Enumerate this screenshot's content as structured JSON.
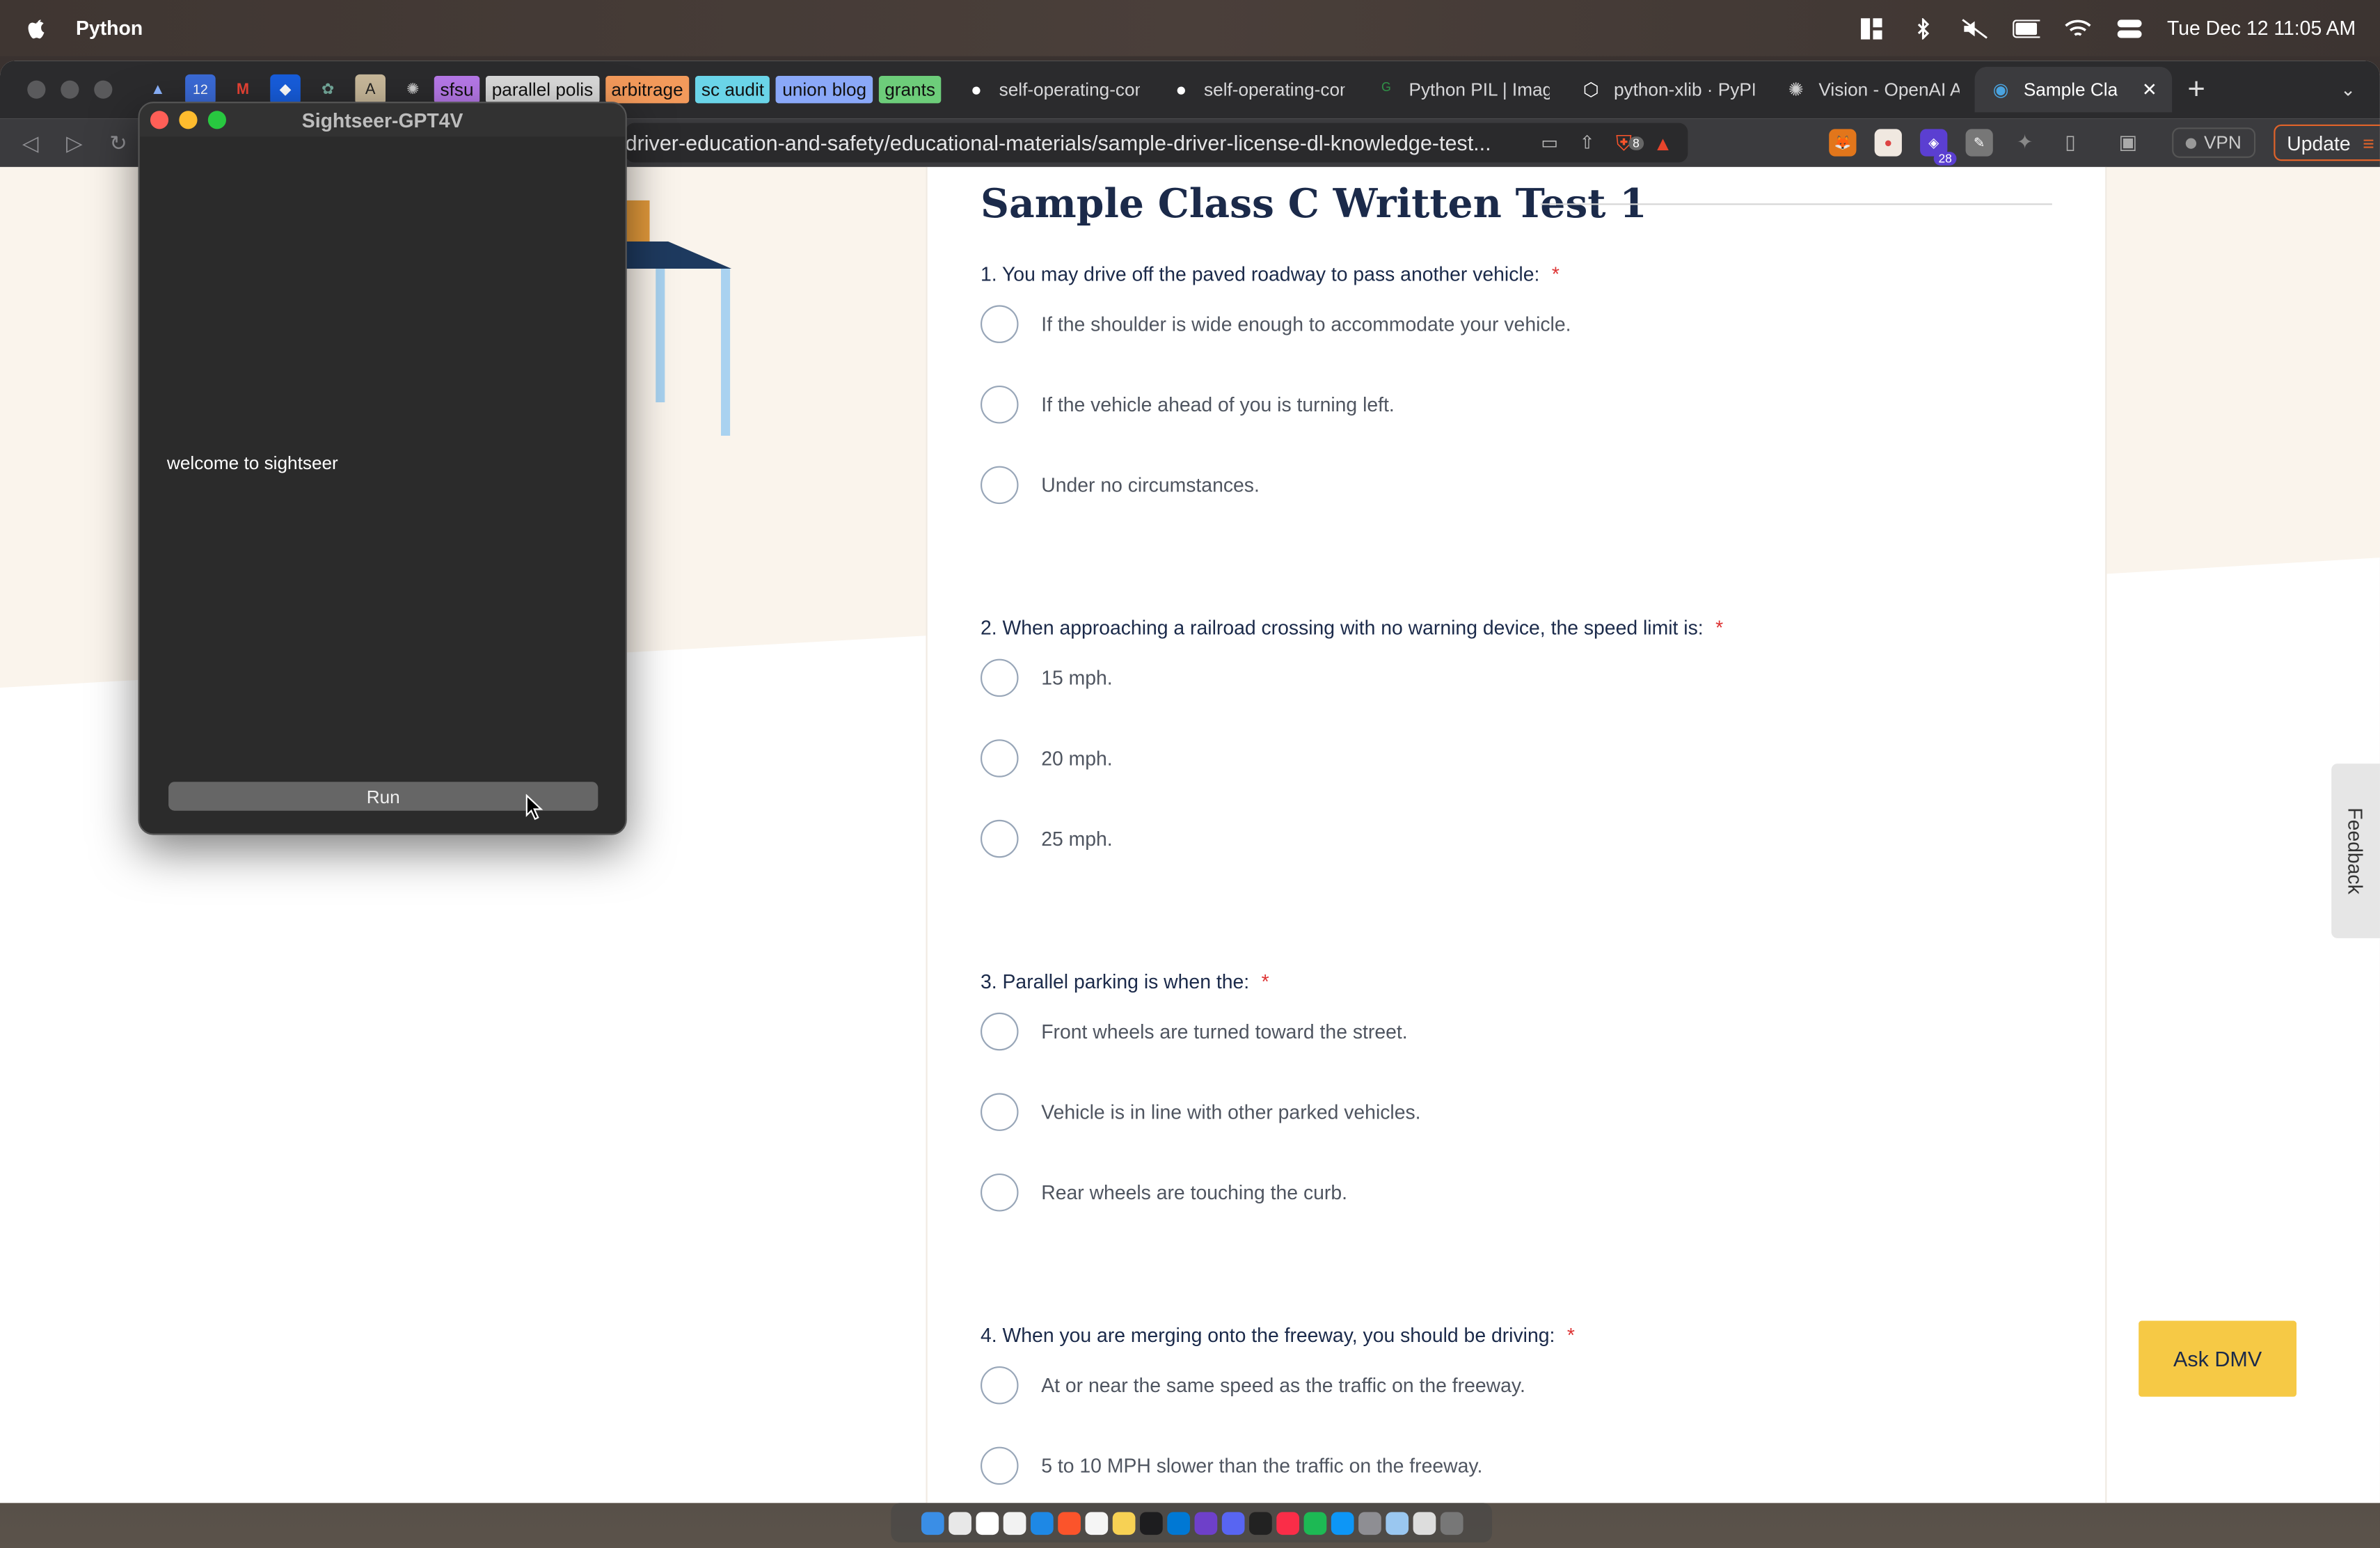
{
  "menubar": {
    "app_name": "Python",
    "clock": "Tue Dec 12  11:05 AM"
  },
  "tabs": {
    "groups": [
      {
        "label": "sfsu",
        "color": "#b678e8"
      },
      {
        "label": "parallel polis",
        "color": "#d9d9d9"
      },
      {
        "label": "arbitrage",
        "color": "#f39a5b"
      },
      {
        "label": "sc audit",
        "color": "#6ad4e8"
      },
      {
        "label": "union blog",
        "color": "#8aa8f8"
      },
      {
        "label": "grants",
        "color": "#6dcd7a"
      }
    ],
    "items": [
      {
        "title": "self-operating-com",
        "icon": "github-icon"
      },
      {
        "title": "self-operating-com",
        "icon": "github-icon"
      },
      {
        "title": "Python PIL | ImageG",
        "icon": "geeks-icon"
      },
      {
        "title": "python-xlib · PyPI",
        "icon": "pypi-icon"
      },
      {
        "title": "Vision - OpenAI API",
        "icon": "openai-icon"
      },
      {
        "title": "Sample Class C",
        "icon": "dmv-icon",
        "active": true
      }
    ]
  },
  "address": {
    "url": "driver-education-and-safety/educational-materials/sample-driver-license-dl-knowledge-test..."
  },
  "toolbar": {
    "brave_badge": "8",
    "ext_badge": "28",
    "vpn_label": "VPN",
    "update_label": "Update"
  },
  "page": {
    "title": "Sample Class C Written Test 1",
    "required_mark": "*",
    "questions": [
      {
        "text": "1. You may drive off the paved roadway to pass another vehicle:",
        "options": [
          "If the shoulder is wide enough to accommodate your vehicle.",
          "If the vehicle ahead of you is turning left.",
          "Under no circumstances."
        ]
      },
      {
        "text": "2. When approaching a railroad crossing with no warning device, the speed limit is:",
        "options": [
          "15 mph.",
          "20 mph.",
          "25 mph."
        ]
      },
      {
        "text": "3. Parallel parking is when the:",
        "options": [
          "Front wheels are turned toward the street.",
          "Vehicle is in line with other parked vehicles.",
          "Rear wheels are touching the curb."
        ]
      },
      {
        "text": "4. When you are merging onto the freeway, you should be driving:",
        "options": [
          "At or near the same speed as the traffic on the freeway.",
          "5 to 10 MPH slower than the traffic on the freeway."
        ]
      }
    ],
    "feedback_label": "Feedback",
    "ask_dmv_label": "Ask DMV"
  },
  "sightseer": {
    "window_title": "Sightseer-GPT4V",
    "welcome_text": "welcome to sightseer",
    "run_label": "Run"
  },
  "dock": {
    "items": [
      "finder-icon",
      "launchpad-icon",
      "calendar-icon",
      "notes-icon",
      "safari-icon",
      "brave-icon",
      "reminders-icon",
      "stickies-icon",
      "xcode-icon",
      "vscode-icon",
      "github-desktop-icon",
      "discord-icon",
      "terminal-icon",
      "music-icon",
      "spotify-icon",
      "appstore-icon",
      "settings-icon",
      "preview-icon",
      "pencil-icon",
      "trash-icon"
    ]
  },
  "colors": {
    "title_navy": "#1b2a4a",
    "required_red": "#dd3333",
    "ask_dmv_yellow": "#f6c945",
    "traffic_red": "#ff5f57",
    "traffic_yellow": "#febc2e",
    "traffic_green": "#28c840"
  }
}
